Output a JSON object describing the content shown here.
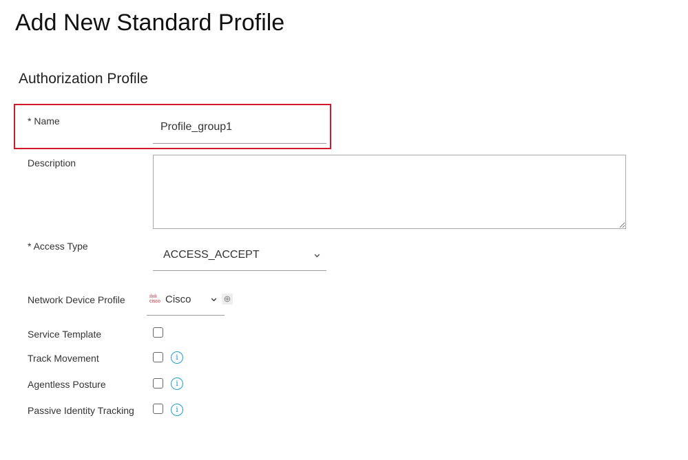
{
  "page": {
    "title": "Add New Standard Profile",
    "section": "Authorization Profile"
  },
  "form": {
    "name_label": "* Name",
    "name_value": "Profile_group1",
    "description_label": "Description",
    "description_value": "",
    "access_type_label": "* Access Type",
    "access_type_value": "ACCESS_ACCEPT",
    "ndp_label": "Network Device Profile",
    "ndp_value": "Cisco",
    "ndp_logo": "cisco",
    "checkboxes": [
      {
        "label": "Service Template",
        "checked": false,
        "info": false
      },
      {
        "label": "Track Movement",
        "checked": false,
        "info": true
      },
      {
        "label": "Agentless Posture",
        "checked": false,
        "info": true
      },
      {
        "label": "Passive Identity Tracking",
        "checked": false,
        "info": true
      }
    ]
  },
  "colors": {
    "highlight": "#d0182a",
    "info": "#1b9bd1"
  }
}
